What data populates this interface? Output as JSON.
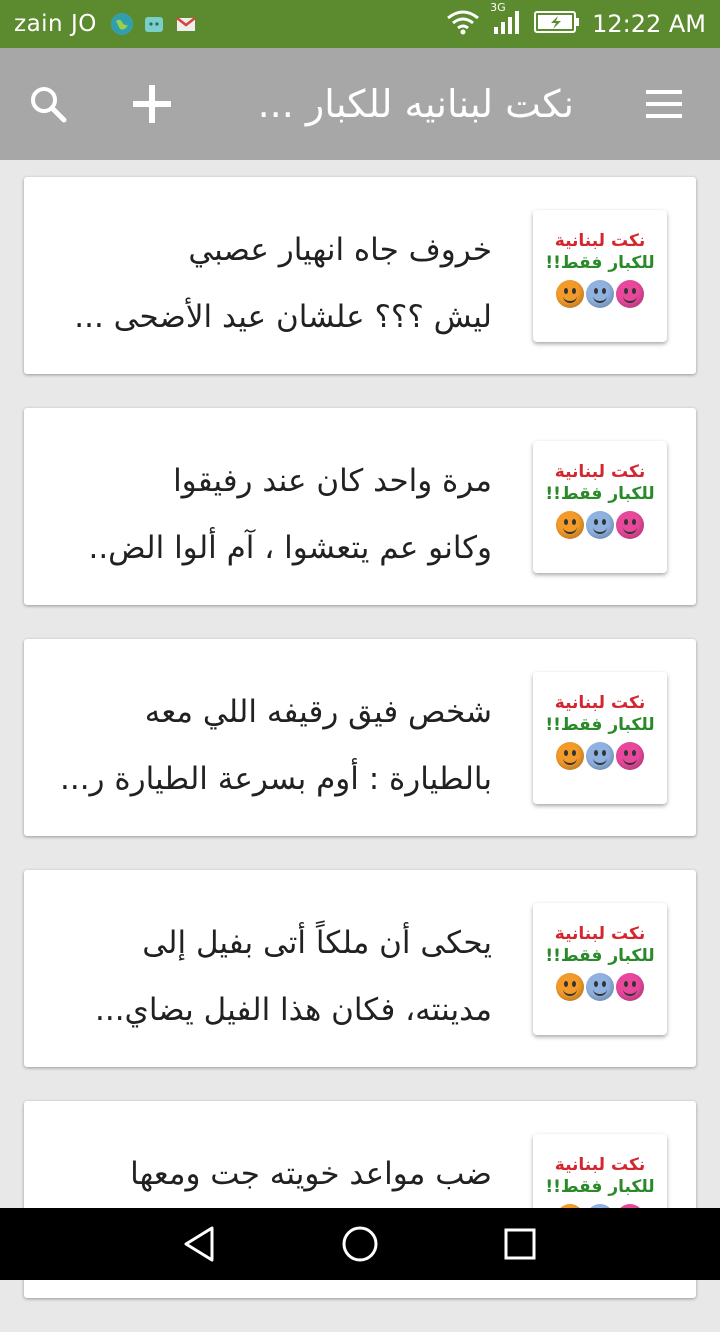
{
  "status_bar": {
    "carrier": "zain JO",
    "network": "3G",
    "time": "12:22 AM",
    "icons": [
      "globe-icon",
      "android-icon",
      "gmail-icon",
      "wifi-icon",
      "signal-icon",
      "battery-charging-icon"
    ]
  },
  "app_bar": {
    "title": "نكت لبنانيه للكبار ...",
    "icons": [
      "search-icon",
      "add-icon",
      "menu-icon"
    ]
  },
  "thumbnail": {
    "line1": "نكت لبنانية",
    "line2": "للكبار فقط!!"
  },
  "jokes": [
    {
      "line1": "خروف جاه انهيار عصبي",
      "line2": "ليش ؟؟؟ علشان عيد الأضحى ..."
    },
    {
      "line1": "مرة واحد كان عند رفيقوا",
      "line2": "وكانو عم يتعشوا ، آم ألوا الض.."
    },
    {
      "line1": "شخص فيق رقيفه اللي معه",
      "line2": "بالطيارة : أوم بسرعة الطيارة ر..."
    },
    {
      "line1": "يحكى أن ملكاً أتى بفيل إلى",
      "line2": "مدينته، فكان هذا الفيل يضاي..."
    },
    {
      "line1": "ضب مواعد خويته جت ومعها",
      "line2": ""
    }
  ],
  "colors": {
    "status_bar": "#5c8a2e",
    "app_bar": "#a7a7a7",
    "background": "#e8e8e8",
    "thumb_red": "#d4262e",
    "thumb_green": "#2a8a2a"
  }
}
